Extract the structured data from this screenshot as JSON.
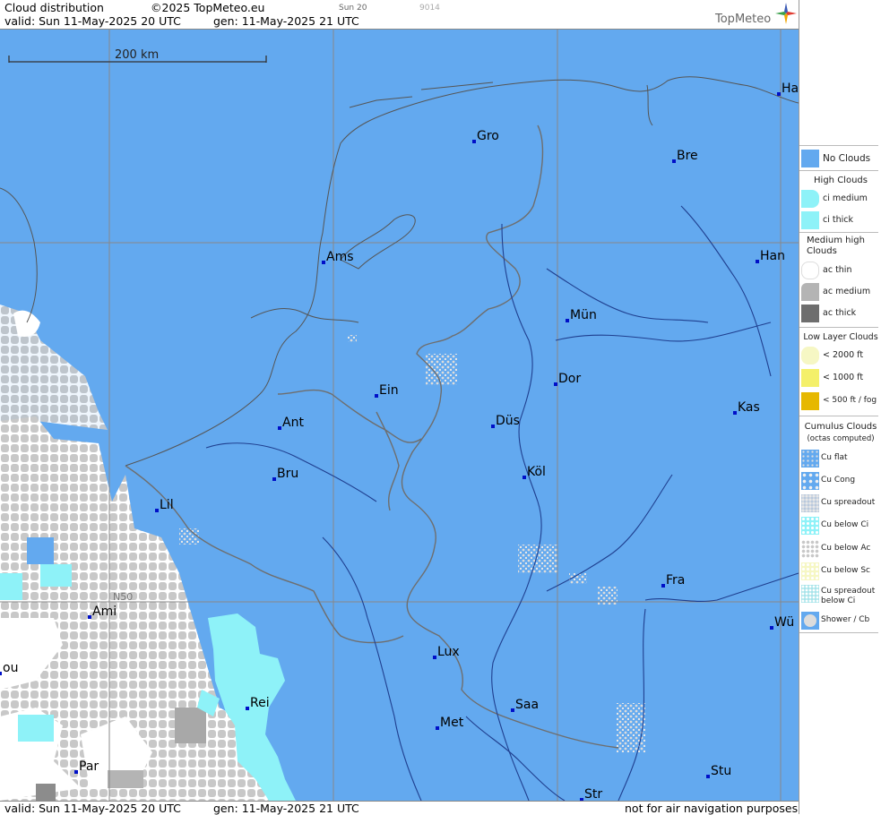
{
  "header": {
    "title": "Cloud distribution",
    "copyright": "©2025 TopMeteo.eu",
    "run": "Sun 20",
    "code": "9014",
    "valid": "valid:  Sun  11-May-2025  20 UTC",
    "gen": "gen: 11-May-2025 21 UTC",
    "logo": "TopMeteo"
  },
  "map": {
    "scale_label": "200 km",
    "grid_label": "N50",
    "cities": [
      "Ha",
      "Gro",
      "Bre",
      "Ams",
      "Han",
      "Mün",
      "Ein",
      "Dor",
      "Ant",
      "Düs",
      "Kas",
      "Bru",
      "Köl",
      "Lil",
      "Fra",
      "Ami",
      "Wü",
      "Lux",
      "ou",
      "Rei",
      "Saa",
      "Met",
      "Par",
      "Stu",
      "Str"
    ]
  },
  "footer": {
    "valid": "valid:  Sun  11-May-2025  20 UTC",
    "gen": "gen: 11-May-2025 21 UTC",
    "disclaimer": "not for air navigation purposes"
  },
  "legend": {
    "no_clouds": "No Clouds",
    "high_title": "High Clouds",
    "ci_medium": "ci medium",
    "ci_thick": "ci thick",
    "medium_title": "Medium high Clouds",
    "ac_thin": "ac thin",
    "ac_medium": "ac medium",
    "ac_thick": "ac thick",
    "low_title": "Low Layer Clouds",
    "low_2000": "< 2000 ft",
    "low_1000": "< 1000 ft",
    "low_500": "< 500 ft / fog",
    "cu_title": "Cumulus Clouds",
    "cu_sub": "(octas computed)",
    "cu_flat": "Cu flat",
    "cu_cong": "Cu Cong",
    "cu_spreadout": "Cu spreadout",
    "cu_below_ci": "Cu below Ci",
    "cu_below_ac": "Cu below Ac",
    "cu_below_sc": "Cu below Sc",
    "cu_spread_ci": "Cu spreadout below Ci",
    "shower": "Shower / Cb"
  },
  "colors": {
    "no_clouds": "#63a9ef",
    "ci": "#8ef2f8",
    "ac_thin": "#ffffff",
    "ac_medium": "#b4b4b4",
    "ac_thick": "#6e6e6e",
    "low_2000": "#f6f7c4",
    "low_1000": "#f4f06a",
    "low_500": "#e6b800"
  }
}
